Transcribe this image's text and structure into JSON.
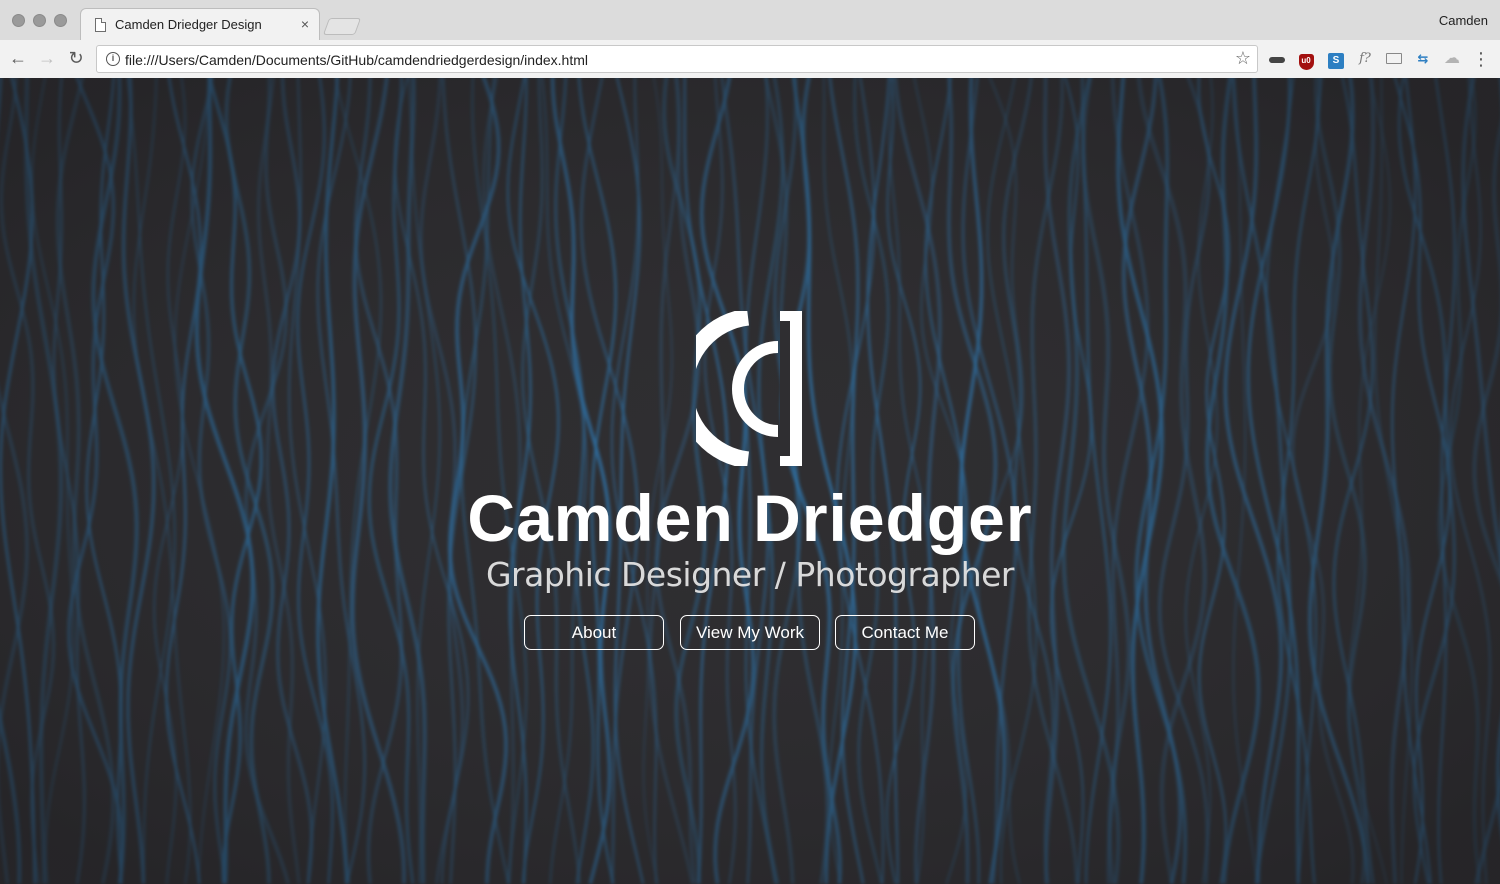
{
  "window": {
    "tab_title": "Camden Driedger Design",
    "tab_close": "×",
    "profile_name": "Camden"
  },
  "toolbar": {
    "back_icon": "←",
    "forward_icon": "→",
    "reload_icon": "↻",
    "info_icon": "i",
    "url": "file:///Users/Camden/Documents/GitHub/camdendriedgerdesign/index.html",
    "bookmark_icon": "☆",
    "menu_icon": "⋮",
    "extensions": [
      {
        "name": "glasses-extension-icon",
        "glyph": ""
      },
      {
        "name": "ublock-extension-icon",
        "glyph": "u0"
      },
      {
        "name": "s-extension-icon",
        "glyph": "S"
      },
      {
        "name": "font-extension-icon",
        "glyph": "f?"
      },
      {
        "name": "screen-extension-icon",
        "glyph": ""
      },
      {
        "name": "arrows-extension-icon",
        "glyph": "⇆"
      },
      {
        "name": "cloud-extension-icon",
        "glyph": "☁"
      }
    ]
  },
  "hero": {
    "name": "Camden Driedger",
    "subtitle": "Graphic Designer / Photographer",
    "buttons": {
      "about": "About",
      "work": "View My Work",
      "contact": "Contact Me"
    }
  },
  "colors": {
    "background": "#2f2e31",
    "wave_blue": "#2e79b3",
    "text": "#ffffff"
  }
}
